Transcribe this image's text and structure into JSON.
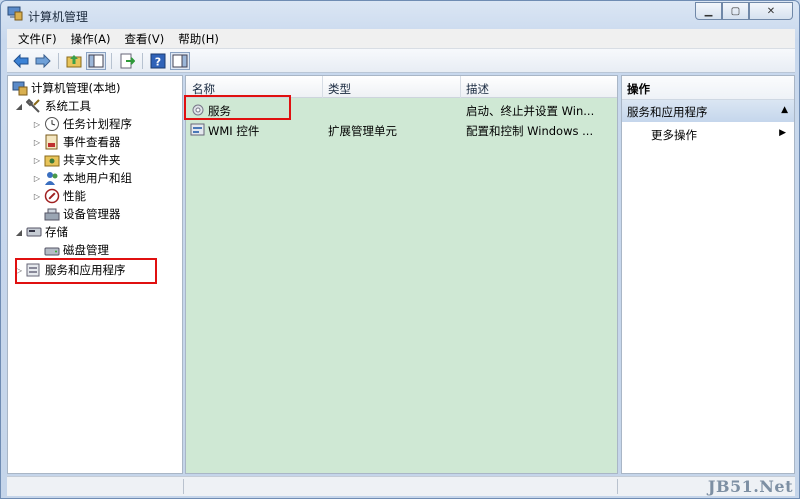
{
  "window": {
    "title": "计算机管理"
  },
  "menu": [
    "文件(F)",
    "操作(A)",
    "查看(V)",
    "帮助(H)"
  ],
  "toolbar": {
    "icons": [
      "back-arrow-icon",
      "forward-arrow-icon",
      "up-folder-icon",
      "show-tree-icon",
      "export-icon",
      "help-icon",
      "show-action-pane-icon"
    ]
  },
  "tree": {
    "root": "计算机管理(本地)",
    "system_tools": "系统工具",
    "task_scheduler": "任务计划程序",
    "event_viewer": "事件查看器",
    "shared_folders": "共享文件夹",
    "local_users": "本地用户和组",
    "performance": "性能",
    "device_manager": "设备管理器",
    "storage": "存储",
    "disk_management": "磁盘管理",
    "services_apps": "服务和应用程序"
  },
  "list": {
    "columns": [
      "名称",
      "类型",
      "描述"
    ],
    "rows": [
      {
        "name": "服务",
        "type": "",
        "desc": "启动、终止并设置 Win..."
      },
      {
        "name": "WMI 控件",
        "type": "扩展管理单元",
        "desc": "配置和控制 Windows ..."
      }
    ]
  },
  "actions": {
    "title": "操作",
    "section": "服务和应用程序",
    "more": "更多操作"
  },
  "watermark": "JB51.Net",
  "colors": {
    "list_bg": "#cfe8d4",
    "highlight": "#e01010",
    "section_bg": "#c5d6ec"
  }
}
